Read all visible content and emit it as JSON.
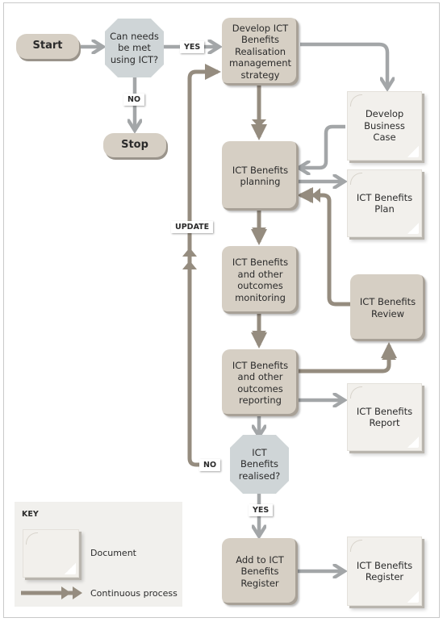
{
  "diagram": {
    "start": "Start",
    "stop": "Stop",
    "decision_ict": "Can needs be met using ICT?",
    "decision_realised": "ICT Benefits realised?",
    "labels": {
      "yes_1": "YES",
      "no_1": "NO",
      "update": "UPDATE",
      "no_2": "NO",
      "yes_2": "YES"
    },
    "processes": {
      "strategy": "Develop ICT Benefits Realisation management strategy",
      "planning": "ICT Benefits planning",
      "monitoring": "ICT Benefits and other outcomes monitoring",
      "reporting": "ICT Benefits and other outcomes reporting",
      "review": "ICT Benefits Review",
      "register_add": "Add to ICT Benefits Register"
    },
    "documents": {
      "business_case": "Develop Business Case",
      "plan": "ICT Benefits Plan",
      "report": "ICT Benefits Report",
      "register": "ICT Benefits Register"
    }
  },
  "key": {
    "title": "KEY",
    "document": "Document",
    "continuous": "Continuous process"
  },
  "colors": {
    "grey_arrow": "#a3a6a8",
    "brown_arrow": "#958c7f",
    "process_fill": "#d6cfc4",
    "decision_fill": "#cfd5d7",
    "document_fill": "#f2f0ec"
  }
}
